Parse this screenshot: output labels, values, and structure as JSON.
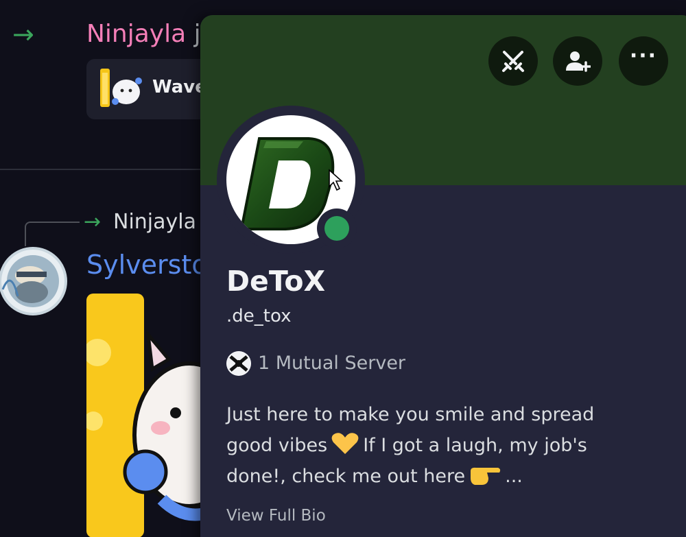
{
  "chat": {
    "join1": {
      "arrow": "→",
      "name": "Ninjayla",
      "rest": " j"
    },
    "wave_card": {
      "label": "Wave"
    },
    "join2": {
      "arrow": "→",
      "name": "Ninjayla"
    },
    "message": {
      "author": "Sylversto"
    }
  },
  "profile": {
    "actions": {
      "more_label": "···"
    },
    "display_name": "DeToX",
    "username": ".de_tox",
    "mutual_servers": "1 Mutual Server",
    "bio": {
      "line1": "Just here to make you smile and spread",
      "line2a": "good vibes",
      "line2b": "If I got a laugh, my job's",
      "line3a": "done!, check me out here",
      "line3b": "..."
    },
    "view_full_bio": "View Full Bio",
    "status": "online",
    "colors": {
      "banner": "#234020",
      "status_online": "#2da05c",
      "card_bg": "#24253a"
    }
  }
}
